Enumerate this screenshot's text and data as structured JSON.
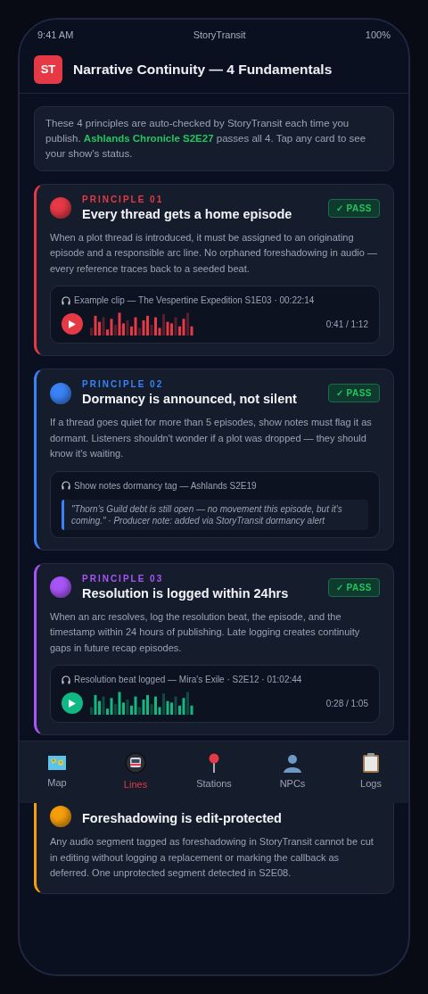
{
  "status_bar": {
    "time": "9:41 AM",
    "app": "StoryTransit",
    "battery": "100%"
  },
  "header": {
    "logo": "ST",
    "title": "Narrative Continuity — 4 Fundamentals"
  },
  "intro": "These 4 principles are auto-checked by StoryTransit each time you publish. **Ashlands Chronicle S2E27** passes all 4. Tap any card to see your show's status.",
  "principles": [
    {
      "label": "PRINCIPLE 01",
      "title": "Every thread gets a home episode",
      "color": "#e63946",
      "status": "✓ PASS",
      "body": "When a plot thread is introduced, it must be assigned to an originating episode and a responsible arc line. No orphaned foreshadowing in audio — every reference traces back to a seeded beat.",
      "attachment": {
        "kind": "player",
        "caption": "Example clip — The Vespertine Expedition S1E03 · 00:22:14",
        "time": "0:41 / 1:12"
      }
    },
    {
      "label": "PRINCIPLE 02",
      "title": "Dormancy is announced, not silent",
      "color": "#3b82f6",
      "status": "✓ PASS",
      "body": "If a thread goes quiet for more than 5 episodes, show notes must flag it as dormant. Listeners shouldn't wonder if a plot was dropped — they should know it's waiting.",
      "attachment": {
        "kind": "note",
        "caption": "Show notes dormancy tag — Ashlands S2E19",
        "quote": "\"Thorn's Guild debt is still open — no movement this episode, but it's coming.\" · Producer note: added via StoryTransit dormancy alert"
      }
    },
    {
      "label": "PRINCIPLE 03",
      "title": "Resolution is logged within 24hrs",
      "color": "#a855f7",
      "status": "✓ PASS",
      "body": "When an arc resolves, log the resolution beat, the episode, and the timestamp within 24 hours of publishing. Late logging creates continuity gaps in future recap episodes.",
      "attachment": {
        "kind": "player",
        "caption": "Resolution beat logged — Mira's Exile · S2E12 · 01:02:44",
        "time": "0:28 / 1:05",
        "color": "#10b981"
      }
    },
    {
      "title": "Foreshadowing is edit-protected",
      "color": "#f59e0b",
      "body": "Any audio segment tagged as foreshadowing in StoryTransit cannot be cut in editing without logging a replacement or marking the callback as deferred. One unprotected segment detected in S2E08."
    }
  ],
  "nav": [
    {
      "label": "Map",
      "selected": false
    },
    {
      "label": "Lines",
      "selected": true
    },
    {
      "label": "Stations",
      "selected": false
    },
    {
      "label": "NPCs",
      "selected": false
    },
    {
      "label": "Logs",
      "selected": false
    }
  ]
}
